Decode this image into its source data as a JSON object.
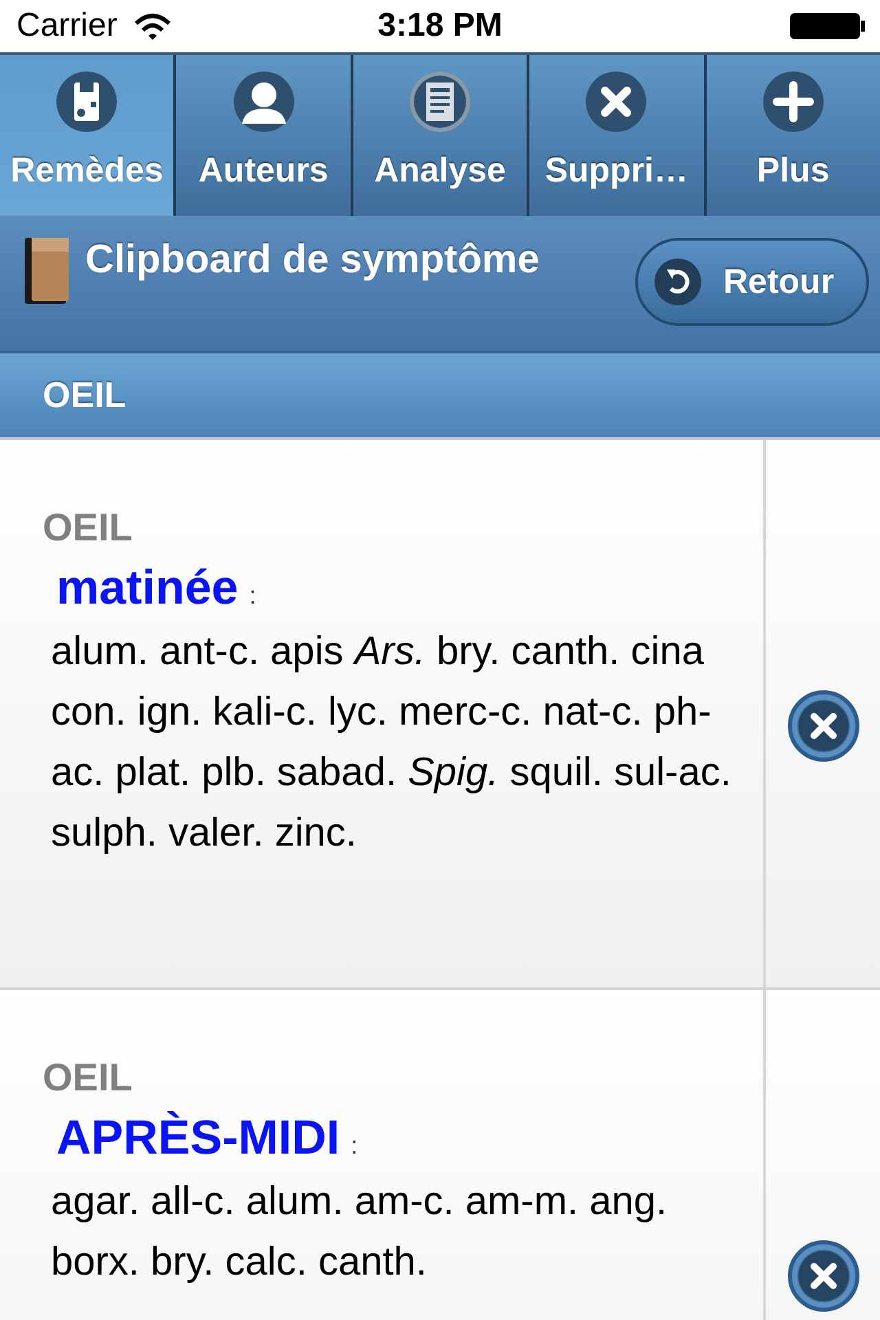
{
  "status_bar": {
    "carrier": "Carrier",
    "time": "3:18 PM"
  },
  "tabs": [
    {
      "label": "Remèdes",
      "kind": "remedy",
      "selected": true
    },
    {
      "label": "Auteurs",
      "kind": "person",
      "selected": false
    },
    {
      "label": "Analyse",
      "kind": "document",
      "selected": false
    },
    {
      "label": "Suppri…",
      "kind": "delete",
      "selected": false
    },
    {
      "label": "Plus",
      "kind": "add",
      "selected": false
    }
  ],
  "header": {
    "title": "Clipboard de symptôme",
    "back_button": "Retour"
  },
  "section": {
    "title": "OEIL"
  },
  "entries": [
    {
      "category": "OEIL",
      "symptom": "matinée",
      "separator": ":",
      "remedies": "alum. ant-c. apis *Ars.* bry. canth. cina con. ign. kali-c. lyc. merc-c. nat-c. ph-ac. plat. plb. sabad. *Spig.* squil. sul-ac. sulph. valer. zinc."
    },
    {
      "category": "OEIL",
      "symptom": "APRÈS-MIDI",
      "separator": ":",
      "remedies": "agar. all-c. alum. am-c. am-m. ang. borx. bry. calc. canth."
    }
  ]
}
